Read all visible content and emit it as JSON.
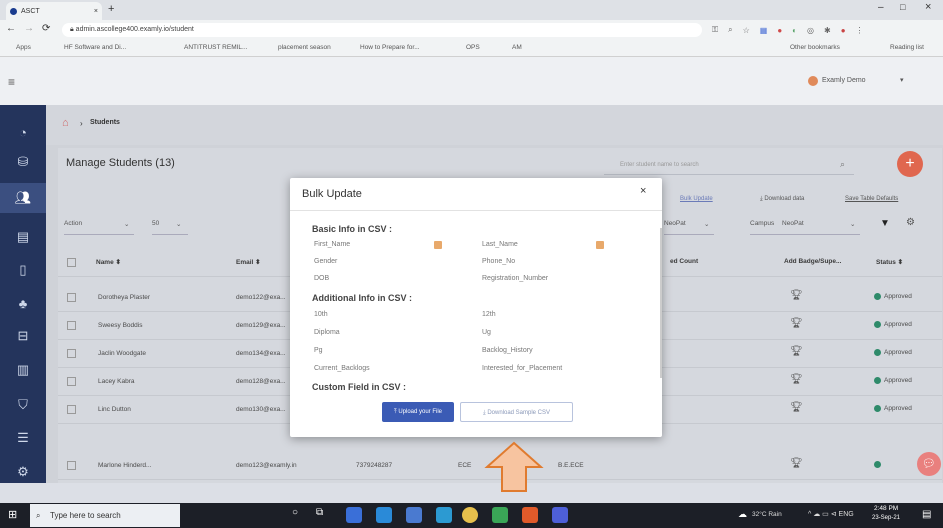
{
  "browser": {
    "tab_title": "ASCT",
    "url": "admin.ascollege400.examly.io/student",
    "bookmarks": [
      "Apps",
      "HF Software and Di...",
      "ANTITRUST REMIL...",
      "placement season",
      "How to Prepare for...",
      "OPS",
      "AM"
    ],
    "other_bookmarks": "Other bookmarks",
    "reading_list": "Reading list"
  },
  "header": {
    "user": "Examly Demo"
  },
  "breadcrumb": {
    "current": "Students"
  },
  "page": {
    "title": "Manage Students (13)",
    "search_placeholder": "Enter student name to search",
    "links": [
      "Bulk Update",
      "Download data",
      "Save Table Defaults"
    ],
    "action_label": "Action",
    "page_size": "50",
    "filter_label": "NeoPat",
    "campus_label": "Campus",
    "campus_value": "NeoPat"
  },
  "table": {
    "headers": [
      "Name",
      "Email",
      "ed Count",
      "Add Badge/Supe...",
      "Status"
    ],
    "rows": [
      {
        "name": "Dorotheya Plaster",
        "email": "demo122@exa...",
        "status": "Approved"
      },
      {
        "name": "Sweesy Boddis",
        "email": "demo129@exa...",
        "status": "Approved"
      },
      {
        "name": "Jaclin Woodgate",
        "email": "demo134@exa...",
        "status": "Approved"
      },
      {
        "name": "Lacey Kabra",
        "email": "demo128@exa...",
        "status": "Approved"
      },
      {
        "name": "Linc Dutton",
        "email": "demo130@exa...",
        "status": "Approved"
      },
      {
        "name": "Marlone Hinderd...",
        "email": "demo123@examly.in",
        "phone": "7379248287",
        "dept": "ECE",
        "degree": "B.E.ECE",
        "status": "Approved"
      }
    ]
  },
  "modal": {
    "title": "Bulk Update",
    "close": "×",
    "sections": [
      {
        "title": "Basic Info in CSV :",
        "fields": [
          [
            "First_Name",
            "Last_Name"
          ],
          [
            "Gender",
            "Phone_No"
          ],
          [
            "DOB",
            "Registration_Number"
          ]
        ]
      },
      {
        "title": "Additional Info in CSV :",
        "fields": [
          [
            "10th",
            "12th"
          ],
          [
            "Diploma",
            "Ug"
          ],
          [
            "Pg",
            "Backlog_History"
          ],
          [
            "Current_Backlogs",
            "Interested_for_Placement"
          ]
        ]
      }
    ],
    "custom_section": "Custom Field in CSV :",
    "upload_button": "Upload your File",
    "download_button": "Download Sample CSV"
  },
  "taskbar": {
    "search": "Type here to search",
    "weather": "32°C Rain",
    "time": "2:48 PM",
    "date": "23-Sep-21"
  },
  "colors": {
    "nav": "#24345c",
    "upload": "#3b5bb5",
    "approved": "#2e8a6a",
    "arrow": "#f4b183",
    "fab": "#e9807e"
  }
}
